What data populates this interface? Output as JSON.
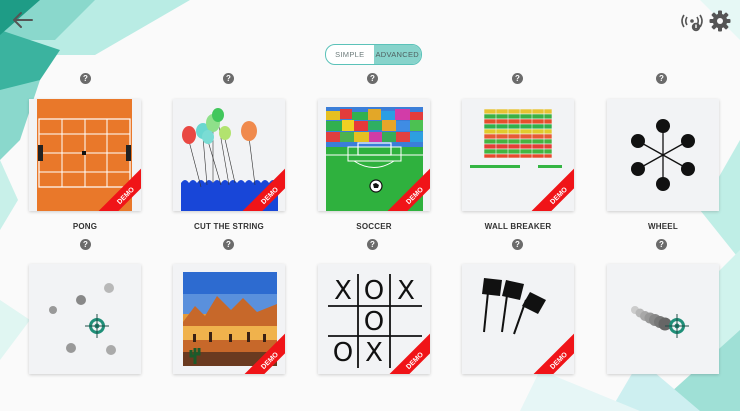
{
  "toggle": {
    "simple": "SIMPLE",
    "advanced": "ADVANCED",
    "selected": "advanced"
  },
  "help_glyph": "?",
  "games": [
    {
      "name": "PONG",
      "demo": true
    },
    {
      "name": "CUT THE STRING",
      "demo": true
    },
    {
      "name": "SOCCER",
      "demo": true
    },
    {
      "name": "WALL BREAKER",
      "demo": true
    },
    {
      "name": "WHEEL",
      "demo": false
    },
    {
      "name": "",
      "demo": false
    },
    {
      "name": "",
      "demo": true
    },
    {
      "name": "",
      "demo": true
    },
    {
      "name": "",
      "demo": true
    },
    {
      "name": "",
      "demo": false
    }
  ],
  "demo_label": "DEMO",
  "tictactoe": [
    "X",
    "O",
    "X",
    "",
    "O",
    "",
    "O",
    "X",
    ""
  ],
  "icons": {
    "back": "arrow-left-icon",
    "signal": "wireless-signal-icon",
    "settings": "gear-icon",
    "help": "question-icon"
  },
  "colors": {
    "accent": "#5bc2b9",
    "demo_ribbon": "#f01418"
  }
}
